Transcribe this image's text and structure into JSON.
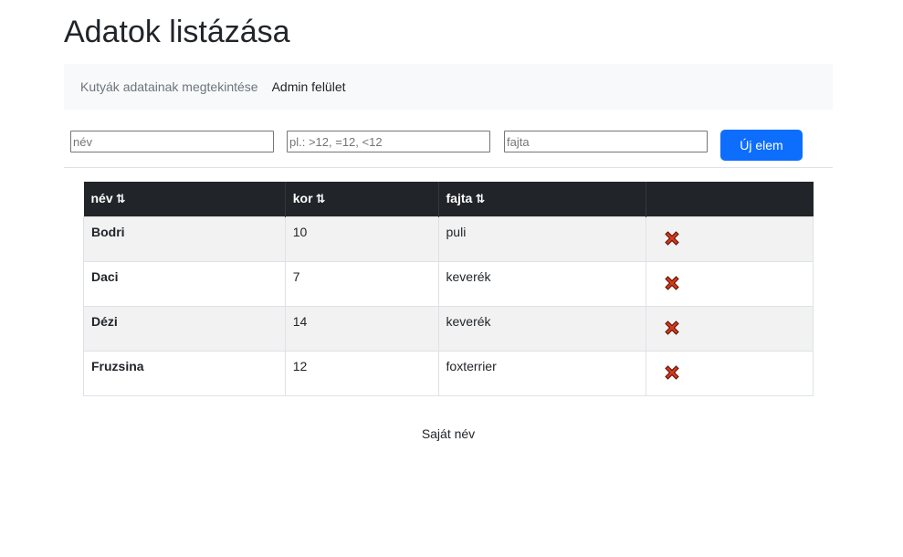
{
  "header": {
    "title": "Adatok listázása"
  },
  "nav": {
    "items": [
      {
        "label": "Kutyák adatainak megtekintése",
        "state": "muted"
      },
      {
        "label": "Admin felület",
        "state": "active"
      }
    ]
  },
  "filters": {
    "name": {
      "placeholder": "név",
      "value": ""
    },
    "age": {
      "placeholder": "pl.: >12, =12, <12",
      "value": ""
    },
    "breed": {
      "placeholder": "fajta",
      "value": ""
    },
    "new_button_label": "Új elem"
  },
  "table": {
    "sort_icon": "sort-arrows-icon",
    "columns": [
      "név",
      "kor",
      "fajta",
      ""
    ],
    "rows": [
      {
        "name": "Bodri",
        "age": "10",
        "breed": "puli"
      },
      {
        "name": "Daci",
        "age": "7",
        "breed": "keverék"
      },
      {
        "name": "Dézi",
        "age": "14",
        "breed": "keverék"
      },
      {
        "name": "Fruzsina",
        "age": "12",
        "breed": "foxterrier"
      }
    ],
    "delete_icon": "delete-x-icon"
  },
  "footer": {
    "text": "Saját név"
  },
  "colors": {
    "primary": "#0d6efd",
    "table_header_bg": "#212529",
    "striped_row_bg": "#f2f2f2",
    "delete_icon_red": "#d43a1c"
  }
}
